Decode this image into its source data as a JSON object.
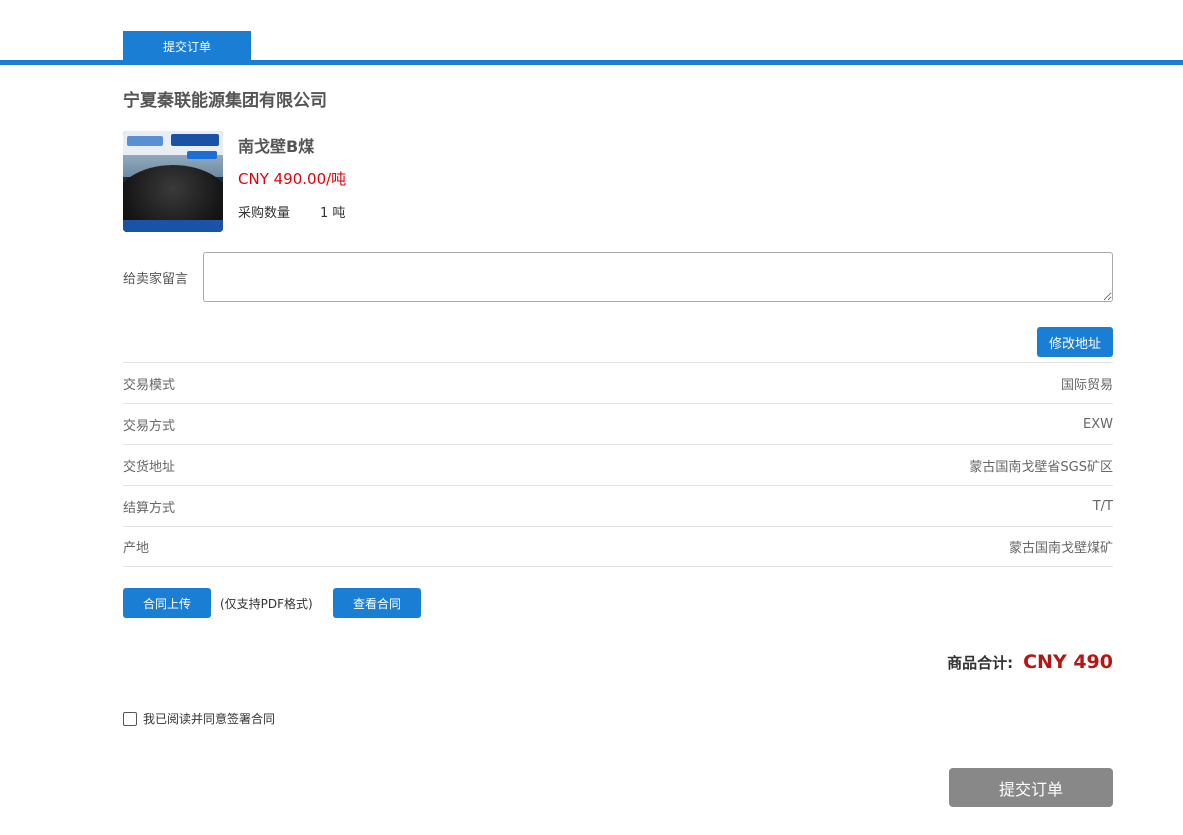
{
  "header": {
    "tab_label": "提交订单"
  },
  "seller": {
    "name": "宁夏秦联能源集团有限公司"
  },
  "product": {
    "name": "南戈壁B煤",
    "price": "CNY 490.00/吨",
    "quantity_label": "采购数量",
    "quantity_value": "1 吨"
  },
  "message": {
    "label": "给卖家留言",
    "value": "",
    "placeholder": ""
  },
  "actions": {
    "modify_address": "修改地址"
  },
  "details": [
    {
      "label": "交易模式",
      "value": "国际贸易"
    },
    {
      "label": "交易方式",
      "value": "EXW"
    },
    {
      "label": "交货地址",
      "value": "蒙古国南戈壁省SGS矿区"
    },
    {
      "label": "结算方式",
      "value": "T/T"
    },
    {
      "label": "产地",
      "value": "蒙古国南戈壁煤矿"
    }
  ],
  "contract": {
    "upload_label": "合同上传",
    "note": "(仅支持PDF格式)",
    "view_label": "查看合同"
  },
  "total": {
    "label": "商品合计:",
    "value": "CNY 490"
  },
  "agreement": {
    "label": "我已阅读并同意签署合同",
    "checked": false
  },
  "submit": {
    "label": "提交订单"
  },
  "colors": {
    "accent": "#1a7fd4",
    "price_red": "#e0000a",
    "total_red": "#b71414",
    "disabled_gray": "#888888"
  }
}
